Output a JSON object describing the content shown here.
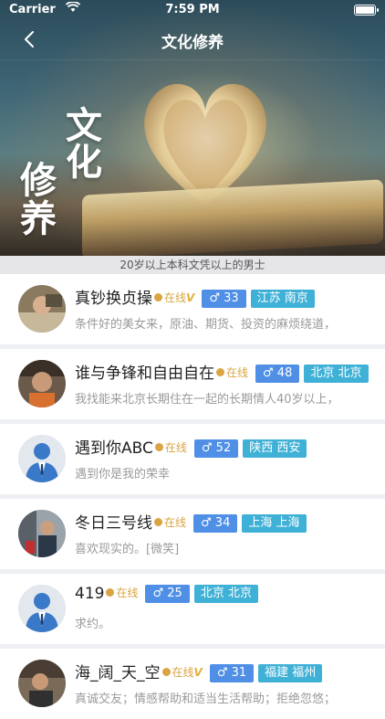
{
  "status": {
    "carrier": "Carrier",
    "time": "7:59 PM"
  },
  "nav": {
    "title": "文化修养"
  },
  "hero": {
    "chars": [
      "文",
      "化",
      "修",
      "养"
    ]
  },
  "subtitle": "20岁以上本科文凭以上的男士",
  "colors": {
    "online": "#d9a441",
    "age_badge": "#4f8fe6",
    "location_badge": "#3fb0d6"
  },
  "users": [
    {
      "name": "真钞换贞操",
      "online": "在线",
      "vip": true,
      "age": "♂ 33",
      "location": "江苏 南京",
      "desc": "条件好的美女来，原油、期货、投资的麻烦绕道，",
      "avatar": "photo"
    },
    {
      "name": "谁与争锋和自由自在",
      "online": "在线",
      "vip": false,
      "age": "♂ 48",
      "location": "北京 北京",
      "desc": "我找能来北京长期住在一起的长期情人40岁以上，",
      "avatar": "photo"
    },
    {
      "name": "遇到你ABC",
      "online": "在线",
      "vip": false,
      "age": "♂ 52",
      "location": "陕西 西安",
      "desc": "遇到你是我的荣幸",
      "avatar": "default"
    },
    {
      "name": "冬日三号线",
      "online": "在线",
      "vip": false,
      "age": "♂ 34",
      "location": "上海 上海",
      "desc": "喜欢现实的。[微笑]",
      "avatar": "photo"
    },
    {
      "name": "419",
      "online": "在线",
      "vip": false,
      "age": "♂ 25",
      "location": "北京 北京",
      "desc": "求约。",
      "avatar": "default"
    },
    {
      "name": "海_阔_天_空",
      "online": "在线",
      "vip": true,
      "age": "♂ 31",
      "location": "福建 福州",
      "desc": "真诚交友；情感帮助和适当生活帮助；拒绝忽悠；",
      "avatar": "photo"
    }
  ]
}
